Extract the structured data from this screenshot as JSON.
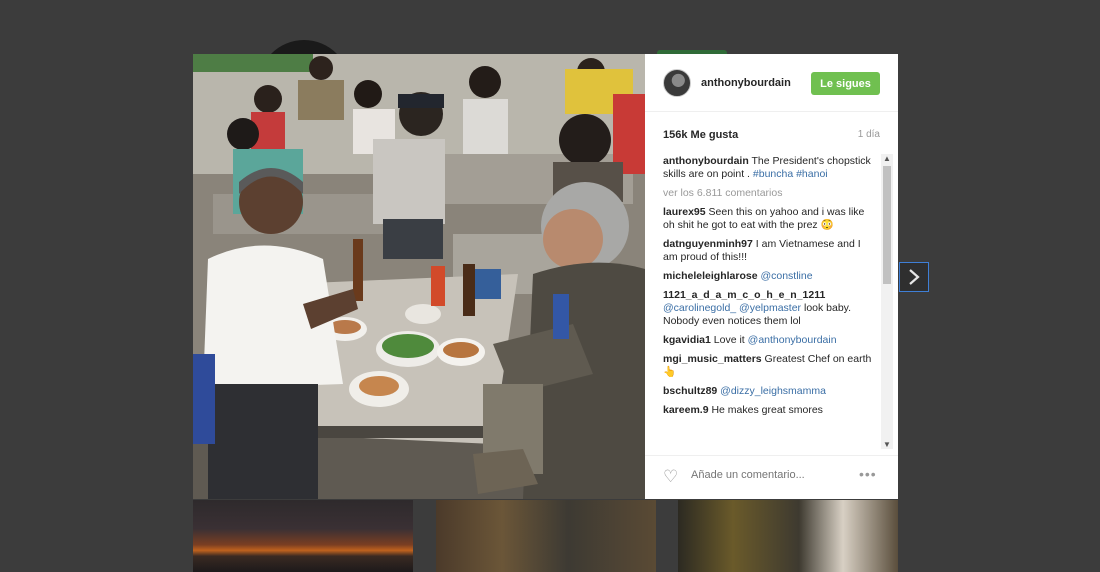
{
  "post": {
    "username": "anthonybourdain",
    "follow_label": "Le sigues",
    "likes": "156k Me gusta",
    "time": "1 día",
    "caption": {
      "user": "anthonybourdain",
      "text": " The President's chopstick skills are on point . ",
      "tags": "#buncha #hanoi"
    },
    "view_all": "ver los 6.811 comentarios",
    "comments": [
      {
        "user": "laurex95",
        "text": " Seen this on yahoo and i was like oh shit he got to eat with the prez 😳",
        "mention": ""
      },
      {
        "user": "datnguyenminh97",
        "text": " I am Vietnamese and I am proud of this!!!",
        "mention": ""
      },
      {
        "user": "micheleleighlarose",
        "text": "",
        "mention": " @constline"
      },
      {
        "user": "1121_a_d_a_m_c_o_h_e_n_1211",
        "text": " look baby. Nobody even notices them lol",
        "mention": " @carolinegold_ @yelpmaster"
      },
      {
        "user": "kgavidia1",
        "text": " Love it ",
        "mention": "@anthonybourdain"
      },
      {
        "user": "mgi_music_matters",
        "text": " Greatest Chef on earth 👆",
        "mention": ""
      },
      {
        "user": "bschultz89",
        "text": "",
        "mention": " @dizzy_leighsmamma"
      },
      {
        "user": "kareem.9",
        "text": " He makes great smores",
        "mention": ""
      }
    ],
    "add_comment_placeholder": "Añade un comentario...",
    "more_label": "•••"
  },
  "icons": {
    "heart": "heart-outline-icon",
    "next": "chevron-right-icon",
    "more": "ellipsis-icon"
  },
  "colors": {
    "follow_button": "#70c050",
    "mention": "#3a6ea5",
    "overlay": "#3c3c3c"
  }
}
